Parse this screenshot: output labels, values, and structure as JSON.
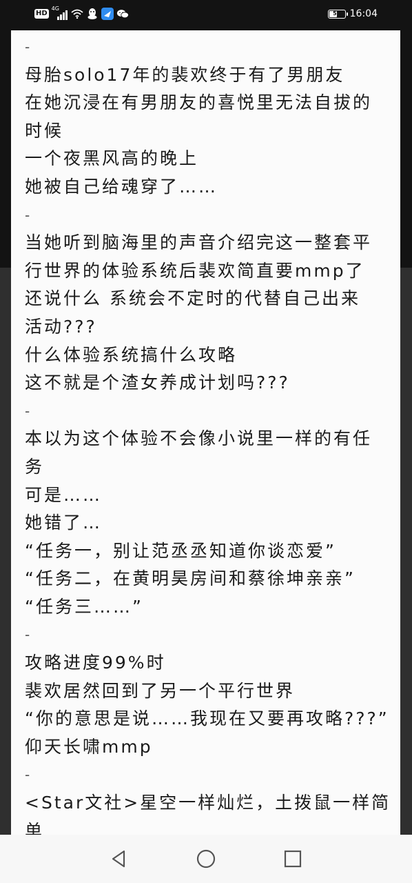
{
  "status_bar": {
    "hd_label": "HD",
    "network_label": "4G",
    "battery_level": "55",
    "battery_fraction": 0.55,
    "time": "16:04",
    "icons": [
      "hd-icon",
      "signal-icon",
      "wifi-icon",
      "qq-icon",
      "feishu-icon",
      "wechat-icon",
      "battery-icon"
    ]
  },
  "content": {
    "lines": [
      "-",
      "母胎solo17年的裴欢终于有了男朋友",
      "在她沉浸在有男朋友的喜悦里无法自拔的",
      "时候",
      "一个夜黑风高的晚上",
      "她被自己给魂穿了……",
      "-",
      "当她听到脑海里的声音介绍完这一整套平",
      "行世界的体验系统后裴欢简直要mmp了",
      "还说什么 系统会不定时的代替自己出来",
      "活动???",
      "什么体验系统搞什么攻略",
      "这不就是个渣女养成计划吗???",
      "-",
      "本以为这个体验不会像小说里一样的有任",
      "务",
      "可是……",
      "她错了…",
      "“任务一，别让范丞丞知道你谈恋爱”",
      "“任务二，在黄明昊房间和蔡徐坤亲亲”",
      "“任务三……”",
      "-",
      "攻略进度99%时",
      "裴欢居然回到了另一个平行世界",
      "“你的意思是说……我现在又要再攻略???”",
      "仰天长啸mmp",
      "-",
      "<Star文社>星空一样灿烂，土拨鼠一样简",
      "单"
    ]
  },
  "nav_bar": {
    "buttons": [
      "back-button",
      "home-button",
      "recents-button"
    ]
  },
  "colors": {
    "background_dark": "#131313",
    "background_mid": "#2f2f2f",
    "card": "#fbfbfb",
    "text": "#1b1b1b",
    "nav": "#f7f7f7",
    "nav_icon": "#555555"
  }
}
